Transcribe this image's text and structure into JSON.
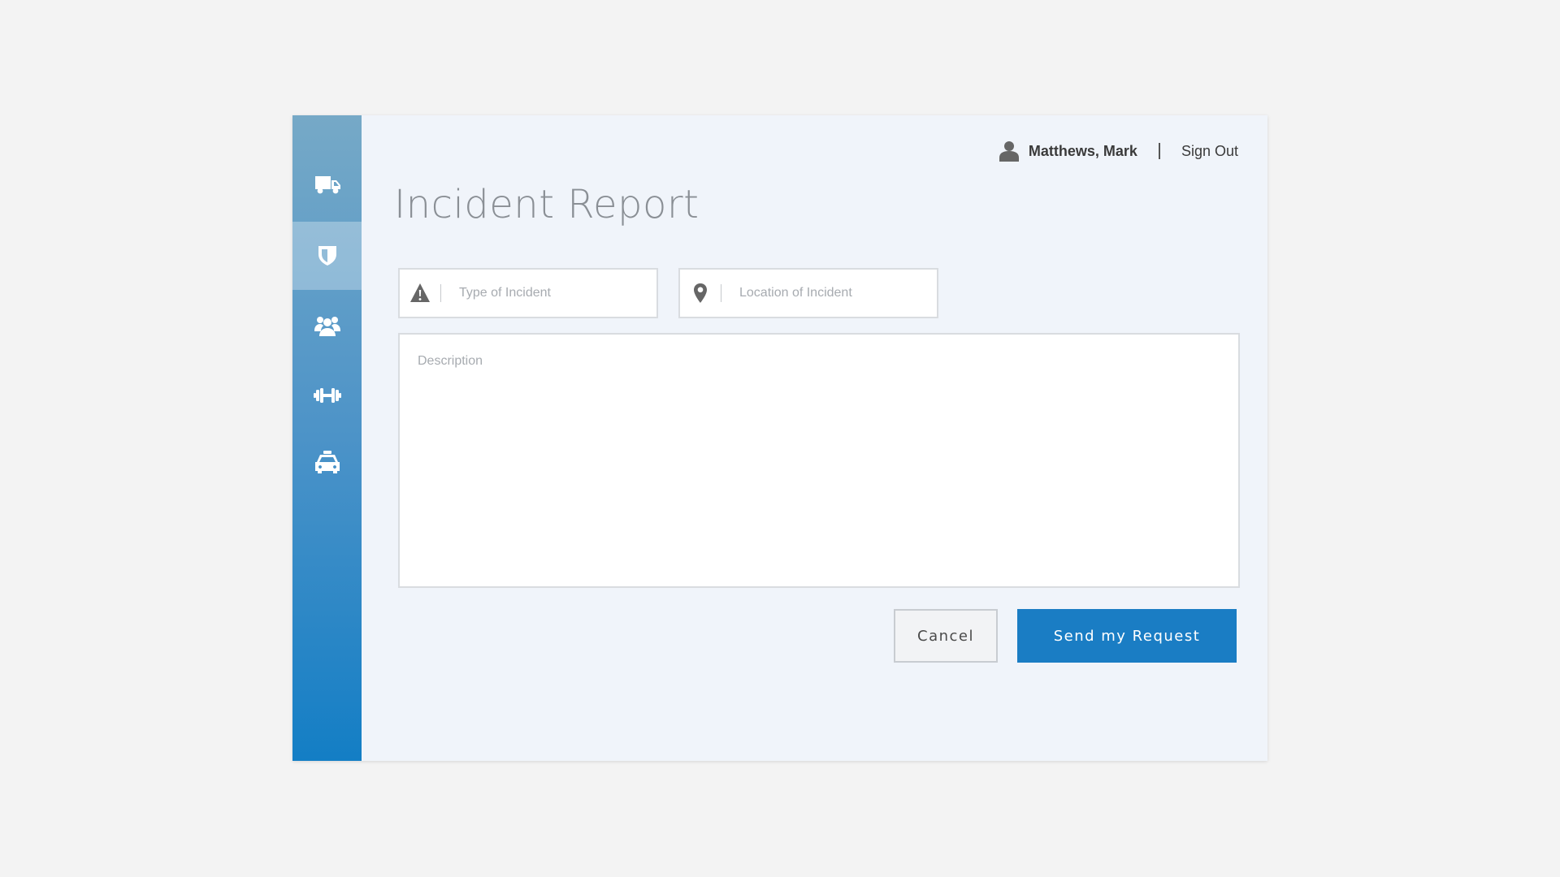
{
  "app": {
    "title": "Incident Report",
    "colors": {
      "accent": "#1a7dc4",
      "sidebar_top": "#76a9c7",
      "sidebar_bottom": "#137ec5",
      "panel_bg": "#f0f4fa"
    }
  },
  "sidebar": {
    "items": [
      {
        "icon": "truck-icon",
        "active": false
      },
      {
        "icon": "shield-icon",
        "active": true
      },
      {
        "icon": "people-group-icon",
        "active": false
      },
      {
        "icon": "dumbbell-icon",
        "active": false
      },
      {
        "icon": "taxi-icon",
        "active": false
      }
    ]
  },
  "header": {
    "user_icon": "user-icon",
    "user_name": "Matthews, Mark",
    "sign_out_label": "Sign Out"
  },
  "form": {
    "type_field": {
      "icon": "warning-icon",
      "placeholder": "Type of Incident",
      "value": ""
    },
    "location_field": {
      "icon": "map-pin-icon",
      "placeholder": "Location of Incident",
      "value": ""
    },
    "description": {
      "placeholder": "Description",
      "value": ""
    },
    "cancel_label": "Cancel",
    "submit_label": "Send my Request"
  }
}
